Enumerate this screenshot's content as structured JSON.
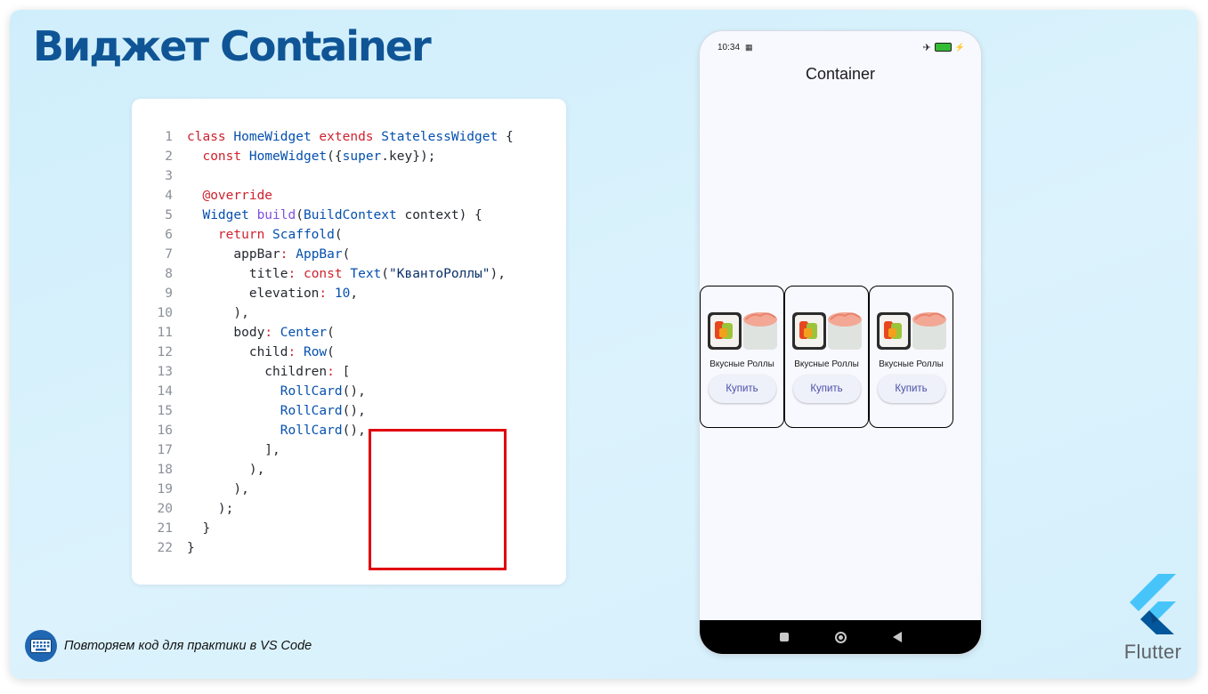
{
  "slide": {
    "title": "Виджет Container",
    "footer_text": "Повторяем код для практики в VS Code",
    "flutter_label": "Flutter"
  },
  "code": {
    "lines": [
      {
        "n": "1",
        "tokens": [
          {
            "t": "class ",
            "c": "kw"
          },
          {
            "t": "HomeWidget ",
            "c": "ty"
          },
          {
            "t": "extends ",
            "c": "kw"
          },
          {
            "t": "StatelessWidget ",
            "c": "ty"
          },
          {
            "t": "{",
            "c": "pl"
          }
        ]
      },
      {
        "n": "2",
        "tokens": [
          {
            "t": "  ",
            "c": "pl"
          },
          {
            "t": "const ",
            "c": "kw"
          },
          {
            "t": "HomeWidget",
            "c": "ty"
          },
          {
            "t": "({",
            "c": "pl"
          },
          {
            "t": "super",
            "c": "ty"
          },
          {
            "t": ".key});",
            "c": "pl"
          }
        ]
      },
      {
        "n": "3",
        "tokens": []
      },
      {
        "n": "4",
        "tokens": [
          {
            "t": "  ",
            "c": "pl"
          },
          {
            "t": "@override",
            "c": "kw"
          }
        ]
      },
      {
        "n": "5",
        "tokens": [
          {
            "t": "  ",
            "c": "pl"
          },
          {
            "t": "Widget ",
            "c": "ty"
          },
          {
            "t": "build",
            "c": "fn"
          },
          {
            "t": "(",
            "c": "pl"
          },
          {
            "t": "BuildContext ",
            "c": "ty"
          },
          {
            "t": "context) {",
            "c": "pl"
          }
        ]
      },
      {
        "n": "6",
        "tokens": [
          {
            "t": "    ",
            "c": "pl"
          },
          {
            "t": "return ",
            "c": "kw"
          },
          {
            "t": "Scaffold",
            "c": "ty"
          },
          {
            "t": "(",
            "c": "pl"
          }
        ]
      },
      {
        "n": "7",
        "tokens": [
          {
            "t": "      appBar",
            "c": "pl"
          },
          {
            "t": ": ",
            "c": "kw"
          },
          {
            "t": "AppBar",
            "c": "ty"
          },
          {
            "t": "(",
            "c": "pl"
          }
        ]
      },
      {
        "n": "8",
        "tokens": [
          {
            "t": "        title",
            "c": "pl"
          },
          {
            "t": ": ",
            "c": "kw"
          },
          {
            "t": "const ",
            "c": "kw"
          },
          {
            "t": "Text",
            "c": "ty"
          },
          {
            "t": "(",
            "c": "pl"
          },
          {
            "t": "\"КвантоРоллы\"",
            "c": "st"
          },
          {
            "t": "),",
            "c": "pl"
          }
        ]
      },
      {
        "n": "9",
        "tokens": [
          {
            "t": "        elevation",
            "c": "pl"
          },
          {
            "t": ": ",
            "c": "kw"
          },
          {
            "t": "10",
            "c": "nm"
          },
          {
            "t": ",",
            "c": "pl"
          }
        ]
      },
      {
        "n": "10",
        "tokens": [
          {
            "t": "      ),",
            "c": "pl"
          }
        ]
      },
      {
        "n": "11",
        "tokens": [
          {
            "t": "      body",
            "c": "pl"
          },
          {
            "t": ": ",
            "c": "kw"
          },
          {
            "t": "Center",
            "c": "ty"
          },
          {
            "t": "(",
            "c": "pl"
          }
        ]
      },
      {
        "n": "12",
        "tokens": [
          {
            "t": "        child",
            "c": "pl"
          },
          {
            "t": ": ",
            "c": "kw"
          },
          {
            "t": "Row",
            "c": "ty"
          },
          {
            "t": "(",
            "c": "pl"
          }
        ]
      },
      {
        "n": "13",
        "tokens": [
          {
            "t": "          children",
            "c": "pl"
          },
          {
            "t": ": ",
            "c": "kw"
          },
          {
            "t": "[",
            "c": "pl"
          }
        ]
      },
      {
        "n": "14",
        "tokens": [
          {
            "t": "            ",
            "c": "pl"
          },
          {
            "t": "RollCard",
            "c": "ty"
          },
          {
            "t": "(),",
            "c": "pl"
          }
        ]
      },
      {
        "n": "15",
        "tokens": [
          {
            "t": "            ",
            "c": "pl"
          },
          {
            "t": "RollCard",
            "c": "ty"
          },
          {
            "t": "(),",
            "c": "pl"
          }
        ]
      },
      {
        "n": "16",
        "tokens": [
          {
            "t": "            ",
            "c": "pl"
          },
          {
            "t": "RollCard",
            "c": "ty"
          },
          {
            "t": "(),",
            "c": "pl"
          }
        ]
      },
      {
        "n": "17",
        "tokens": [
          {
            "t": "          ],",
            "c": "pl"
          }
        ]
      },
      {
        "n": "18",
        "tokens": [
          {
            "t": "        ),",
            "c": "pl"
          }
        ]
      },
      {
        "n": "19",
        "tokens": [
          {
            "t": "      ),",
            "c": "pl"
          }
        ]
      },
      {
        "n": "20",
        "tokens": [
          {
            "t": "    );",
            "c": "pl"
          }
        ]
      },
      {
        "n": "21",
        "tokens": [
          {
            "t": "  }",
            "c": "pl"
          }
        ]
      },
      {
        "n": "22",
        "tokens": [
          {
            "t": "}",
            "c": "pl"
          }
        ]
      }
    ]
  },
  "phone": {
    "status_time": "10:34",
    "battery": "100",
    "appbar_title": "Container",
    "cards": [
      {
        "label": "Вкусные Роллы",
        "button": "Купить"
      },
      {
        "label": "Вкусные Роллы",
        "button": "Купить"
      },
      {
        "label": "Вкусные Роллы",
        "button": "Купить"
      }
    ]
  },
  "colors": {
    "title": "#0f5596",
    "highlight_box": "#e0000c",
    "button_text": "#4a50a8"
  },
  "icons": {
    "footer": "keyboard-icon",
    "brand": "flutter-logo-icon"
  }
}
